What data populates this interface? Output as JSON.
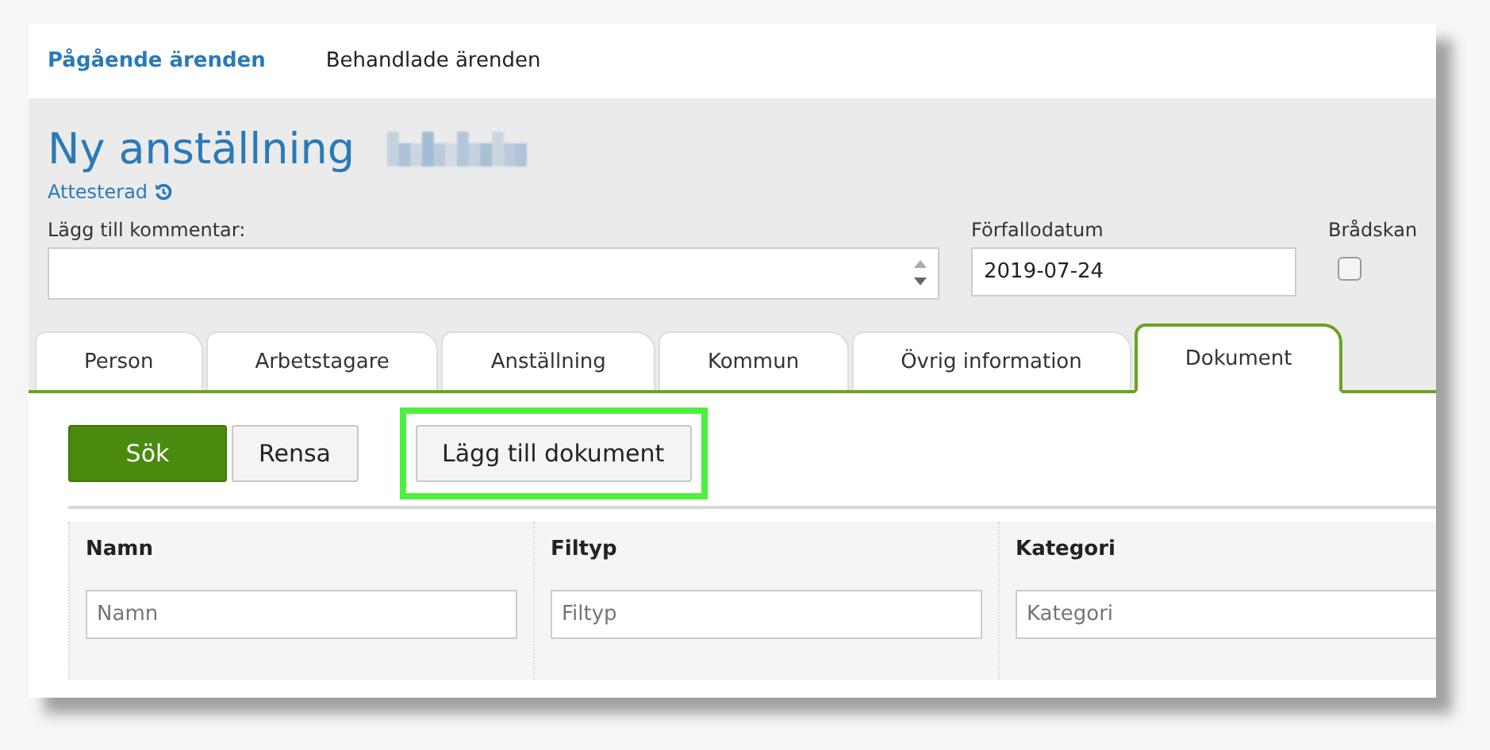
{
  "nav": [
    {
      "label": "Pågående ärenden",
      "selected": true
    },
    {
      "label": "Behandlade ärenden",
      "selected": false
    }
  ],
  "title": "Ny anställning",
  "status": "Attesterad",
  "comment": {
    "label": "Lägg till kommentar:"
  },
  "due_date": {
    "label": "Förfallodatum",
    "value": "2019-07-24"
  },
  "urgent": {
    "label": "Brådskan",
    "checked": false
  },
  "tabs": [
    {
      "label": "Person",
      "selected": false
    },
    {
      "label": "Arbetstagare",
      "selected": false
    },
    {
      "label": "Anställning",
      "selected": false
    },
    {
      "label": "Kommun",
      "selected": false
    },
    {
      "label": "Övrig information",
      "selected": false
    },
    {
      "label": "Dokument",
      "selected": true
    }
  ],
  "buttons": [
    {
      "label": "Sök",
      "kind": "primary",
      "highlighted": false
    },
    {
      "label": "Rensa",
      "kind": "default",
      "highlighted": false
    },
    {
      "label": "Lägg till dokument",
      "kind": "default",
      "highlighted": true
    }
  ],
  "table": {
    "columns": [
      {
        "header": "Namn",
        "placeholder": "Namn"
      },
      {
        "header": "Filtyp",
        "placeholder": "Filtyp"
      },
      {
        "header": "Kategori",
        "placeholder": "Kategori"
      }
    ]
  }
}
